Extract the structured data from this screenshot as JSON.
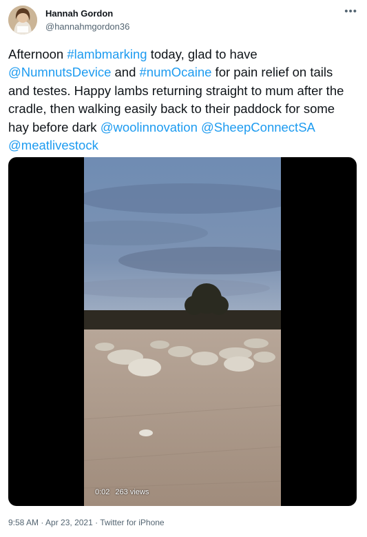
{
  "user": {
    "name": "Hannah Gordon",
    "handle": "@hannahmgordon36"
  },
  "more_icon": "more-horizontal-icon",
  "tweet": {
    "segments": [
      {
        "text": "Afternoon ",
        "link": false
      },
      {
        "text": "#lambmarking",
        "link": true
      },
      {
        "text": " today, glad to have ",
        "link": false
      },
      {
        "text": "@NumnutsDevice",
        "link": true
      },
      {
        "text": " and ",
        "link": false
      },
      {
        "text": "#numOcaine",
        "link": true
      },
      {
        "text": " for pain relief on tails and testes. Happy lambs returning straight to mum after the cradle, then walking easily back to their paddock for some hay before dark ",
        "link": false
      },
      {
        "text": "@woolinnovation",
        "link": true
      },
      {
        "text": " ",
        "link": false
      },
      {
        "text": "@SheepConnectSA",
        "link": true
      },
      {
        "text": " ",
        "link": false
      },
      {
        "text": "@meatlivestock",
        "link": true
      }
    ]
  },
  "video": {
    "duration": "0:02",
    "views": "263 views"
  },
  "meta": {
    "time": "9:58 AM",
    "separator": " · ",
    "date": "Apr 23, 2021",
    "app": "Twitter for iPhone"
  },
  "colors": {
    "link": "#1d9bf0",
    "secondary_text": "#536471",
    "primary_text": "#0f1419"
  }
}
